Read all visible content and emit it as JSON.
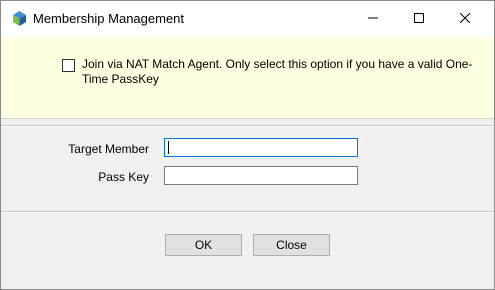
{
  "window": {
    "title": "Membership Management",
    "app_icon": "app-logo-icon",
    "controls": {
      "minimize_icon": "minimize-icon",
      "maximize_icon": "maximize-icon",
      "close_icon": "close-icon"
    }
  },
  "banner": {
    "background_color": "#ffffe1",
    "checkbox_checked": false,
    "option_text": "Join via NAT Match Agent. Only select this option if you have a valid One-Time PassKey"
  },
  "form": {
    "target_member": {
      "label": "Target Member",
      "value": ""
    },
    "pass_key": {
      "label": "Pass Key",
      "value": ""
    }
  },
  "buttons": {
    "ok_label": "OK",
    "close_label": "Close"
  }
}
